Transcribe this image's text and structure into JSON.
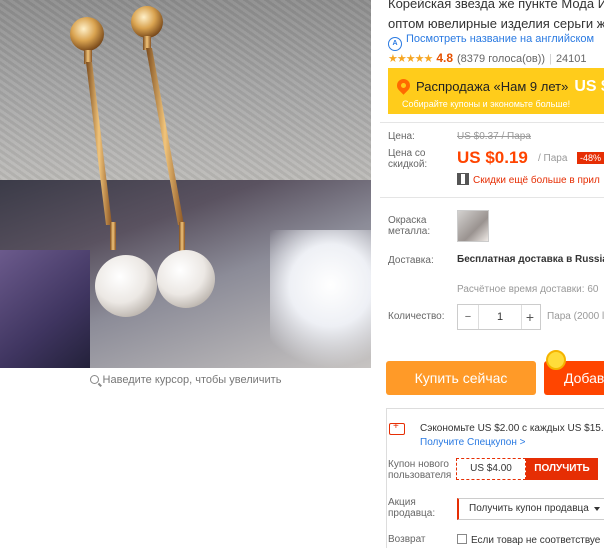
{
  "product": {
    "title_line1": "Корейская звезда же пункте Мода Им",
    "title_line2": "оптом ювелирные изделия серьги же",
    "translate_link": "Посмотреть название на английском",
    "rating": {
      "stars": "★★★★★",
      "score": "4.8",
      "votes": "(8379 голоса(ов))",
      "orders_partial": "24101"
    }
  },
  "image": {
    "zoom_hint": "Наведите курсор, чтобы увеличить"
  },
  "promo": {
    "title": "Распродажа «Нам 9 лет»",
    "title_price": "US $",
    "subtitle": "Собирайте купоны и экономьте больше!"
  },
  "price": {
    "label": "Цена:",
    "old_price": "US $0.37 / Пара",
    "discount_label": "Цена со скидкой:",
    "new_price": "US $0.19",
    "unit": "/ Пара",
    "discount_badge": "-48%",
    "app_deal": "Скидки ещё больше в прил"
  },
  "metal": {
    "label": "Окраска металла:"
  },
  "shipping": {
    "label": "Доставка:",
    "free": "Бесплатная доставка в Russia",
    "estimated": "Расчётное время доставки: 60"
  },
  "quantity": {
    "label": "Количество:",
    "minus": "−",
    "value": "1",
    "plus": "+",
    "unit": "Пара (2000 l"
  },
  "actions": {
    "buy_now": "Купить сейчас",
    "add_to_cart": "Добав"
  },
  "coupons": {
    "save_text": "Сэкономьте US $2.00 с каждых US $15.",
    "special_link": "Получите Спецкупон >",
    "new_user_label": "Купон нового пользователя",
    "new_user_amount": "US $4.00",
    "get_button": "ПОЛУЧИТЬ",
    "seller_label": "Акция продавца:",
    "seller_select": "Получить купон продавца",
    "return_label": "Возврат",
    "return_text": "Если товар не соответствуе"
  },
  "colors": {
    "accent": "#ff4400",
    "promo_bg": "#ffcc1b",
    "buy": "#ff9a28",
    "link": "#2a7ae2"
  }
}
